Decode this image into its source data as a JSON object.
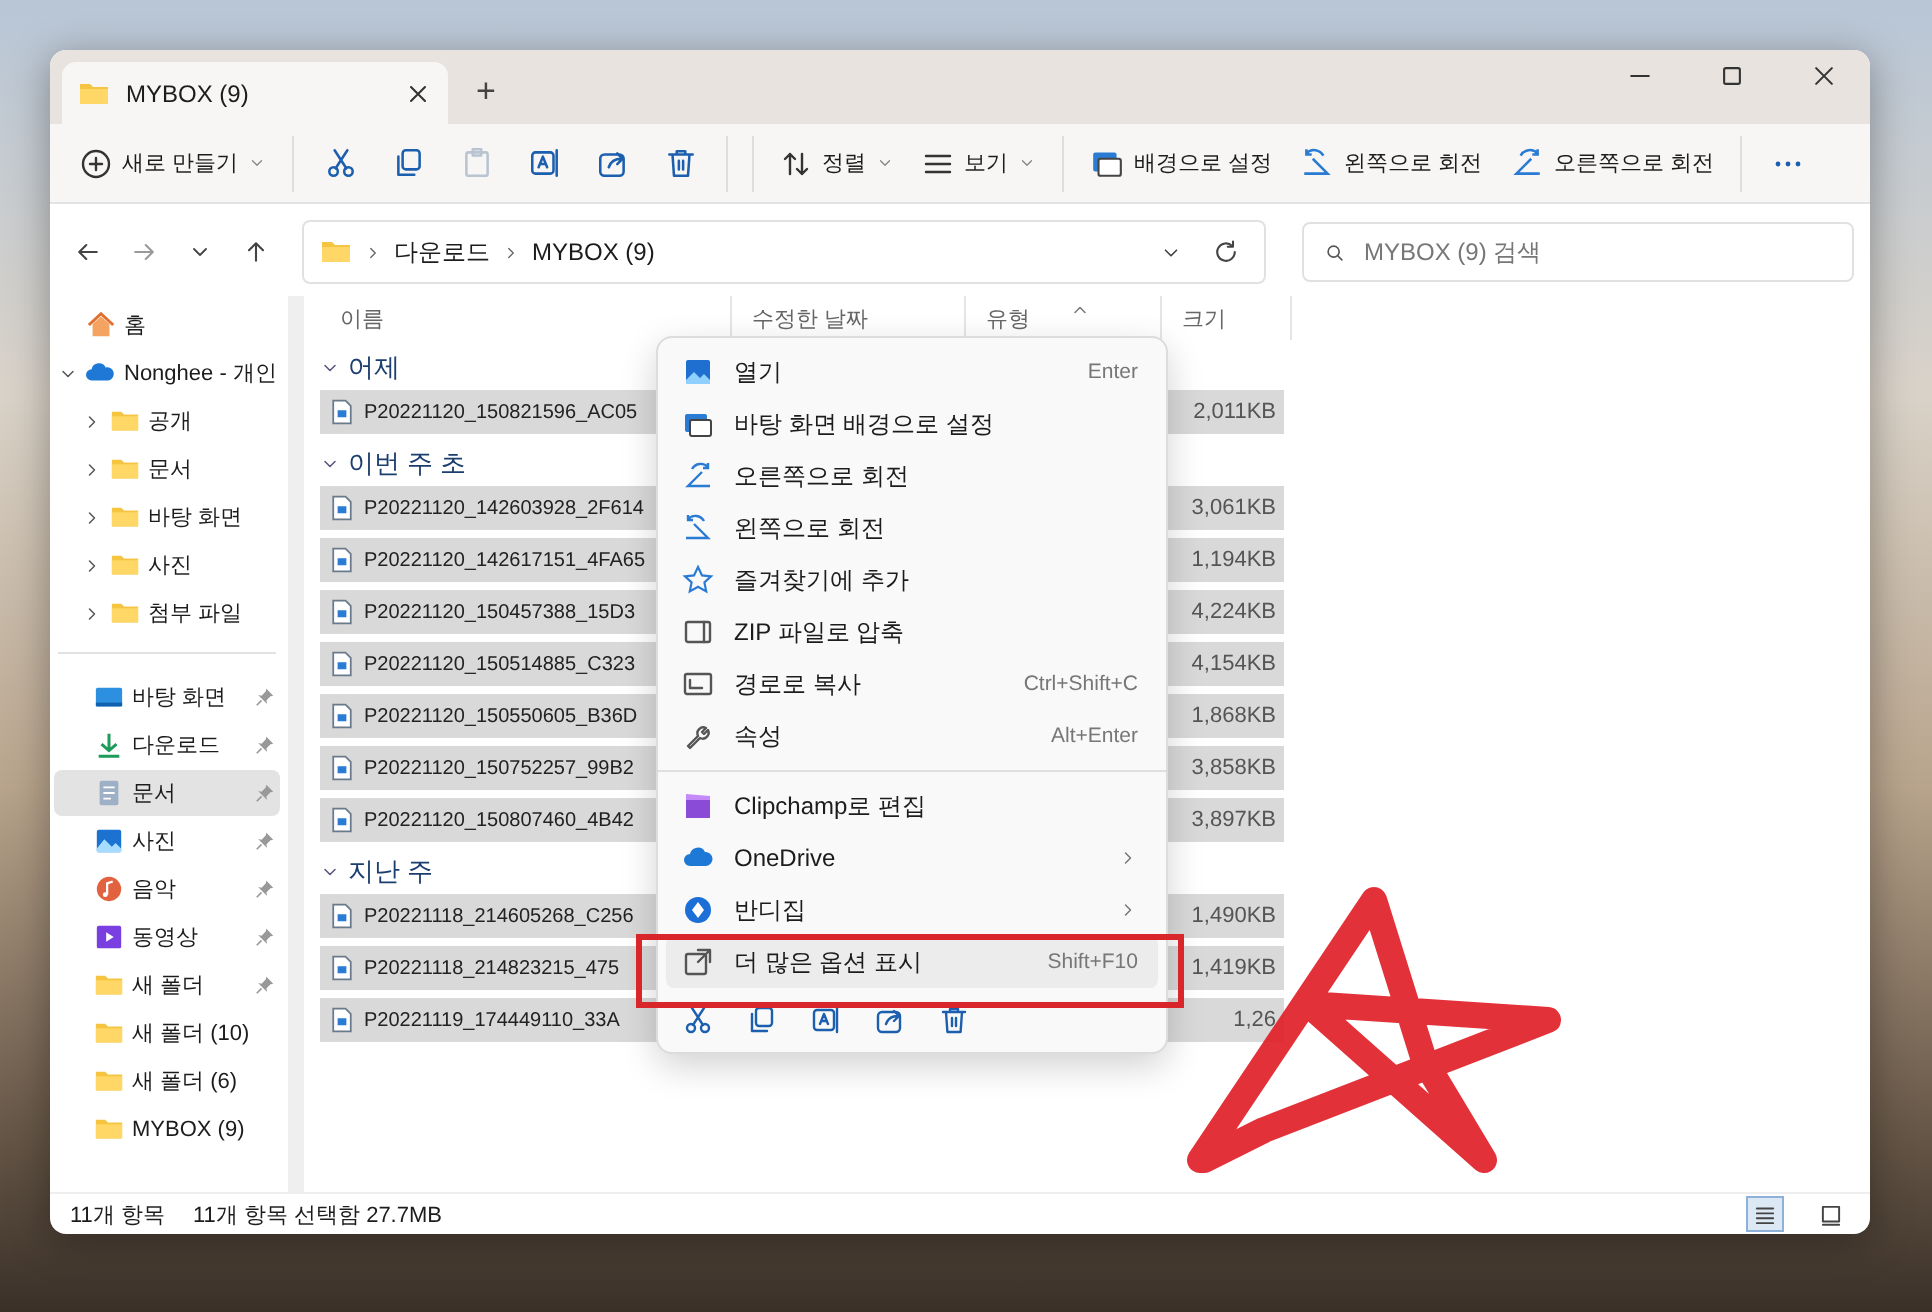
{
  "window": {
    "tab_title": "MYBOX (9)",
    "new_tab": "+"
  },
  "toolbar": [
    {
      "kind": "menu",
      "label": "새로 만들기",
      "disabled": false
    },
    {
      "kind": "icon",
      "disabled": false
    },
    {
      "kind": "icon",
      "disabled": false
    },
    {
      "kind": "icon",
      "disabled": true
    },
    {
      "kind": "icon",
      "disabled": false
    },
    {
      "kind": "icon",
      "disabled": false
    },
    {
      "kind": "icon",
      "disabled": false
    },
    {
      "kind": "menu",
      "label": "정렬",
      "disabled": false
    },
    {
      "kind": "menu",
      "label": "보기",
      "disabled": false
    },
    {
      "kind": "action",
      "label": "배경으로 설정",
      "disabled": false
    },
    {
      "kind": "action",
      "label": "왼쪽으로 회전",
      "disabled": false
    },
    {
      "kind": "action",
      "label": "오른쪽으로 회전",
      "disabled": false
    },
    {
      "kind": "more",
      "disabled": false
    }
  ],
  "address": {
    "crumbs": [
      "다운로드",
      "MYBOX (9)"
    ]
  },
  "search": {
    "placeholder": "MYBOX (9) 검색"
  },
  "sidebar": {
    "items": [
      {
        "label": "홈",
        "selected": false,
        "pinned": false
      },
      {
        "label": "Nonghee - 개인",
        "selected": false,
        "pinned": false,
        "expanded": true,
        "children": [
          {
            "label": "공개",
            "expanded": false
          },
          {
            "label": "문서",
            "expanded": false
          },
          {
            "label": "바탕 화면",
            "expanded": false
          },
          {
            "label": "사진",
            "expanded": false
          },
          {
            "label": "첨부 파일",
            "expanded": false
          }
        ]
      }
    ],
    "quick_access": [
      {
        "label": "바탕 화면",
        "selected": false,
        "pinned": true
      },
      {
        "label": "다운로드",
        "selected": false,
        "pinned": true
      },
      {
        "label": "문서",
        "selected": true,
        "pinned": true
      },
      {
        "label": "사진",
        "selected": false,
        "pinned": true
      },
      {
        "label": "음악",
        "selected": false,
        "pinned": true
      },
      {
        "label": "동영상",
        "selected": false,
        "pinned": true
      },
      {
        "label": "새 폴더",
        "selected": false,
        "pinned": true
      },
      {
        "label": "새 폴더 (10)",
        "selected": false,
        "pinned": false
      },
      {
        "label": "새 폴더 (6)",
        "selected": false,
        "pinned": false
      },
      {
        "label": "MYBOX (9)",
        "selected": false,
        "pinned": false
      }
    ]
  },
  "table": {
    "columns": [
      {
        "label": "이름",
        "sorted": false
      },
      {
        "label": "수정한 날짜",
        "sorted": false
      },
      {
        "label": "유형",
        "sorted": true
      },
      {
        "label": "크기",
        "sorted": false
      }
    ],
    "groups": [
      {
        "title": "어제",
        "expanded": true,
        "rows": [
          {
            "name": "P20221120_150821596_AC05",
            "size": "2,011KB",
            "selected": true
          }
        ]
      },
      {
        "title": "이번 주 초",
        "expanded": true,
        "rows": [
          {
            "name": "P20221120_142603928_2F614",
            "size": "3,061KB",
            "selected": true
          },
          {
            "name": "P20221120_142617151_4FA65",
            "size": "1,194KB",
            "selected": true
          },
          {
            "name": "P20221120_150457388_15D3",
            "size": "4,224KB",
            "selected": true
          },
          {
            "name": "P20221120_150514885_C323",
            "size": "4,154KB",
            "selected": true
          },
          {
            "name": "P20221120_150550605_B36D",
            "size": "1,868KB",
            "selected": true
          },
          {
            "name": "P20221120_150752257_99B2",
            "size": "3,858KB",
            "selected": true
          },
          {
            "name": "P20221120_150807460_4B42",
            "size": "3,897KB",
            "selected": true
          }
        ]
      },
      {
        "title": "지난 주",
        "expanded": true,
        "rows": [
          {
            "name": "P20221118_214605268_C256",
            "size": "1,490KB",
            "selected": true
          },
          {
            "name": "P20221118_214823215_475",
            "size": "1,419KB",
            "selected": true
          },
          {
            "name": "P20221119_174449110_33A",
            "size": "1,26",
            "selected": true
          }
        ]
      }
    ]
  },
  "context_menu": {
    "groups": [
      {
        "items": [
          {
            "label": "열기",
            "shortcut": "Enter",
            "submenu": false,
            "hovered": false
          },
          {
            "label": "바탕 화면 배경으로 설정",
            "submenu": false,
            "hovered": false
          },
          {
            "label": "오른쪽으로 회전",
            "submenu": false,
            "hovered": false
          },
          {
            "label": "왼쪽으로 회전",
            "submenu": false,
            "hovered": false
          },
          {
            "label": "즐겨찾기에 추가",
            "submenu": false,
            "hovered": false
          },
          {
            "label": "ZIP 파일로 압축",
            "submenu": false,
            "hovered": false
          },
          {
            "label": "경로로 복사",
            "shortcut": "Ctrl+Shift+C",
            "submenu": false,
            "hovered": false
          },
          {
            "label": "속성",
            "shortcut": "Alt+Enter",
            "submenu": false,
            "hovered": false
          }
        ]
      },
      {
        "items": [
          {
            "label": "Clipchamp로 편집",
            "submenu": false,
            "hovered": false
          },
          {
            "label": "OneDrive",
            "submenu": true,
            "hovered": false
          },
          {
            "label": "반디집",
            "submenu": true,
            "hovered": false
          },
          {
            "label": "더 많은 옵션 표시",
            "shortcut": "Shift+F10",
            "submenu": false,
            "hovered": true
          }
        ]
      }
    ]
  },
  "status_bar": {
    "count": "11개 항목",
    "selection": "11개 항목 선택함 27.7MB",
    "views": [
      {
        "selected": true
      },
      {
        "selected": false
      }
    ]
  }
}
